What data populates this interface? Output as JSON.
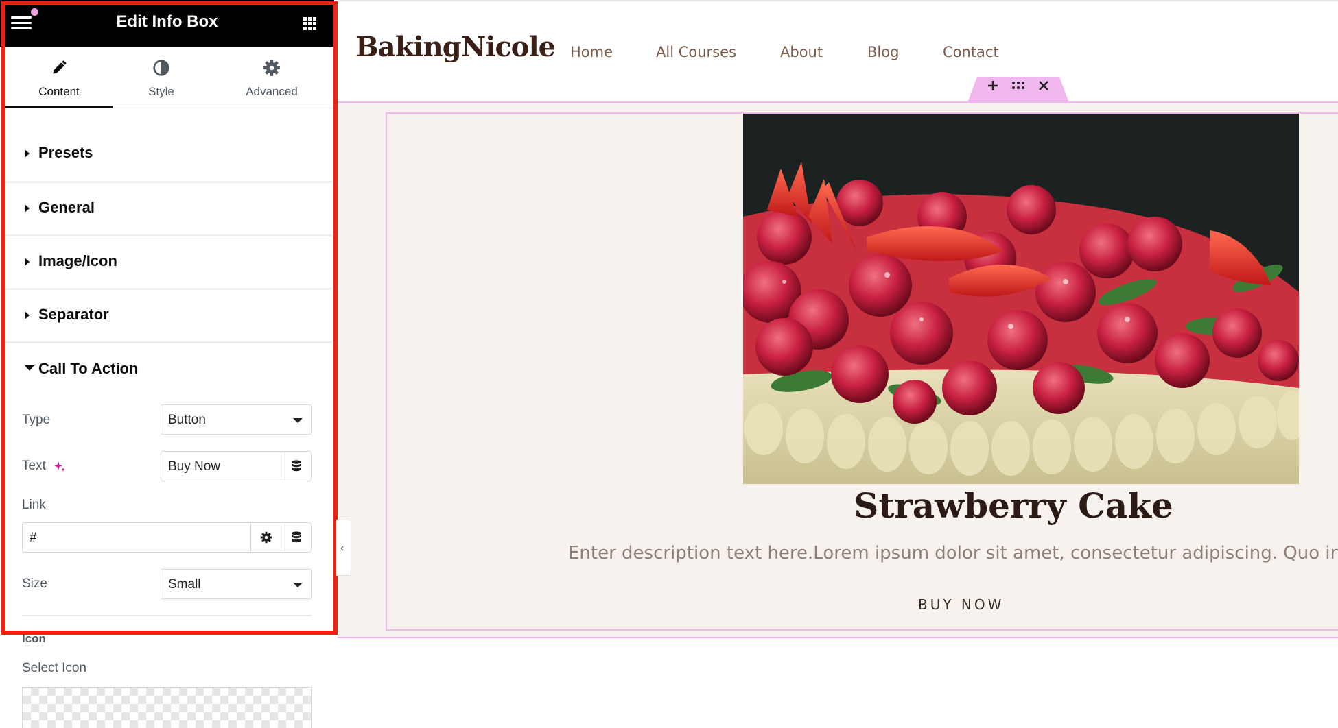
{
  "panel": {
    "title": "Edit Info Box",
    "tabs": [
      {
        "label": "Content",
        "icon": "pencil-icon",
        "active": true
      },
      {
        "label": "Style",
        "icon": "half-circle-icon",
        "active": false
      },
      {
        "label": "Advanced",
        "icon": "gear-icon",
        "active": false
      }
    ],
    "sections": [
      {
        "label": "Presets",
        "expanded": false
      },
      {
        "label": "General",
        "expanded": false
      },
      {
        "label": "Image/Icon",
        "expanded": false
      },
      {
        "label": "Separator",
        "expanded": false
      },
      {
        "label": "Call To Action",
        "expanded": true
      }
    ],
    "cta": {
      "type_label": "Type",
      "type_value": "Button",
      "text_label": "Text",
      "text_value": "Buy Now",
      "link_label": "Link",
      "link_value": "#",
      "size_label": "Size",
      "size_value": "Small"
    },
    "below": {
      "icon_heading": "Icon",
      "select_icon_label": "Select Icon"
    },
    "accent_color": "#ee2211"
  },
  "site": {
    "logo": "BakingNicole",
    "nav": [
      "Home",
      "All Courses",
      "About",
      "Blog",
      "Contact"
    ],
    "card": {
      "title": "Strawberry Cake",
      "description": "Enter description text here.Lorem ipsum dolor sit amet, consectetur adipiscing. Quo inc",
      "button": "BUY NOW"
    },
    "toolbar": {
      "add_icon": "plus-icon",
      "drag_icon": "drag-dots-icon",
      "close_icon": "close-icon"
    },
    "handle_glyph": "‹"
  }
}
